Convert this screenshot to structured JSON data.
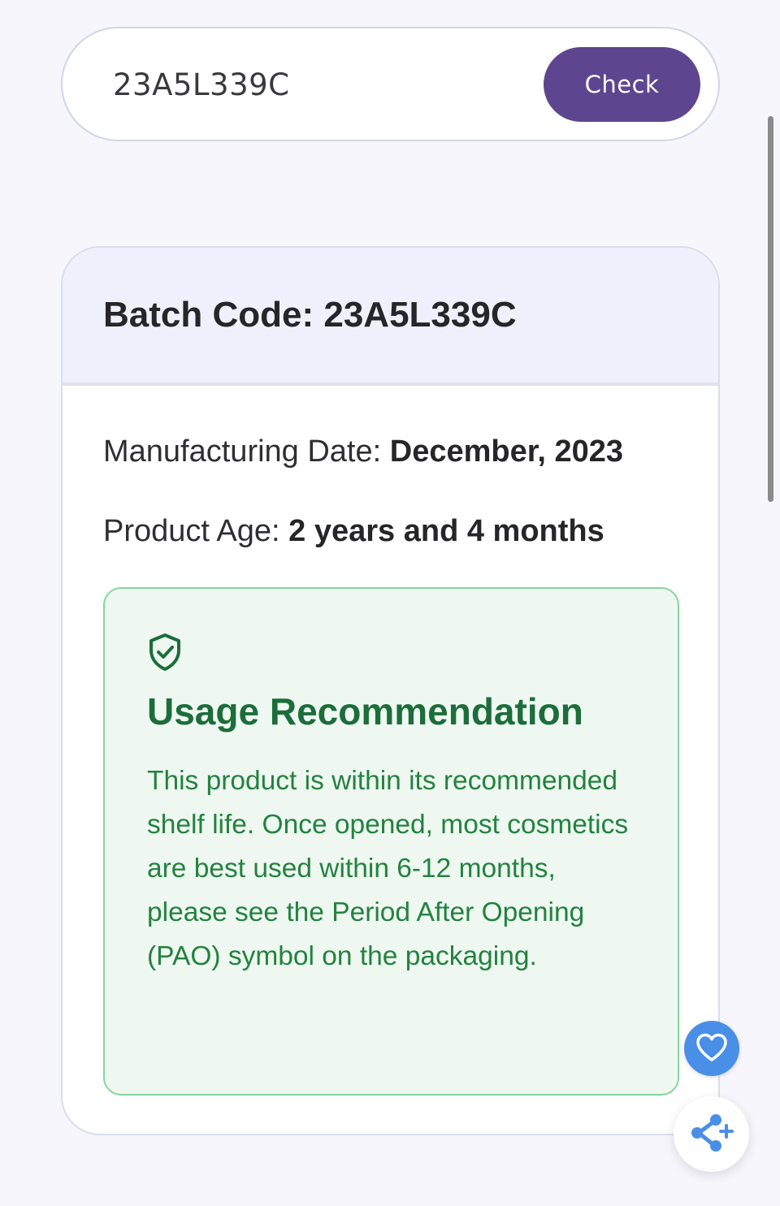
{
  "search": {
    "value": "23A5L339C",
    "button_label": "Check"
  },
  "result": {
    "title": "Batch Code: 23A5L339C",
    "manufacturing_label": "Manufacturing Date:",
    "manufacturing_value": "December, 2023",
    "age_label": "Product Age:",
    "age_value": "2 years and 4 months"
  },
  "recommendation": {
    "icon": "shield-check-icon",
    "title": "Usage Recommendation",
    "text": "This product is within its recommended shelf life. Once opened, most cosmetics are best used within 6-12 months, please see the Period After Opening (PAO) symbol on the packaging."
  },
  "floating_actions": {
    "favorite_icon": "heart-icon",
    "share_icon": "share-plus-icon"
  },
  "colors": {
    "accent": "#5d468f",
    "success_text": "#1c6d3a",
    "success_bg": "#eef8f1",
    "favorite_bg": "#4a8fe7"
  }
}
